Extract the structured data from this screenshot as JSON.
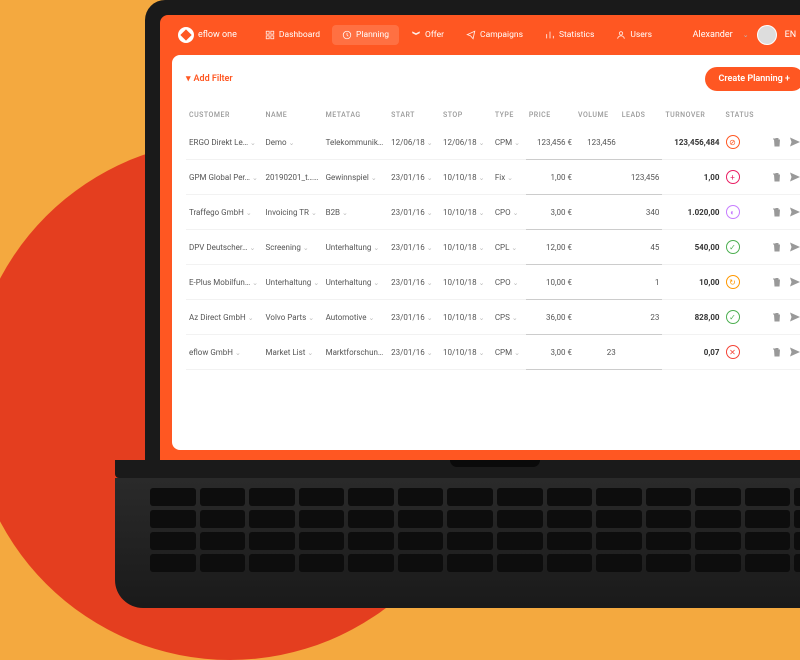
{
  "brand": "eflow one",
  "nav": {
    "dashboard": "Dashboard",
    "planning": "Planning",
    "offer": "Offer",
    "campaigns": "Campaigns",
    "statistics": "Statistics",
    "users": "Users"
  },
  "user": {
    "name": "Alexander",
    "lang": "EN"
  },
  "toolbar": {
    "add_filter": "Add Filter",
    "create": "Create Planning +"
  },
  "columns": {
    "customer": "CUSTOMER",
    "name": "NAME",
    "metatag": "METATAG",
    "start": "START",
    "stop": "STOP",
    "type": "TYPE",
    "price": "PRICE",
    "volume": "VOLUME",
    "leads": "LEADS",
    "turnover": "TURNOVER",
    "status": "STATUS"
  },
  "rows": [
    {
      "customer": "ERGO Direkt Le…",
      "name": "Demo",
      "metatag": "Telekommunikation",
      "start": "12/06/18",
      "stop": "12/06/18",
      "type": "CPM",
      "price": "123,456 €",
      "volume": "123,456",
      "leads": "",
      "turnover": "123,456,484",
      "status": "block"
    },
    {
      "customer": "GPM Global Per…",
      "name": "20190201_t…",
      "metatag": "Gewinnspiel",
      "start": "23/01/16",
      "stop": "10/10/18",
      "type": "Fix",
      "price": "1,00 €",
      "volume": "",
      "leads": "123,456",
      "turnover": "1,00",
      "status": "plus"
    },
    {
      "customer": "Traffego GmbH",
      "name": "Invoicing TR",
      "metatag": "B2B",
      "start": "23/01/16",
      "stop": "10/10/18",
      "type": "CPO",
      "price": "3,00 €",
      "volume": "",
      "leads": "340",
      "turnover": "1.020,00",
      "status": "wait"
    },
    {
      "customer": "DPV Deutscher…",
      "name": "Screening",
      "metatag": "Unterhaltung",
      "start": "23/01/16",
      "stop": "10/10/18",
      "type": "CPL",
      "price": "12,00 €",
      "volume": "",
      "leads": "45",
      "turnover": "540,00",
      "status": "ok"
    },
    {
      "customer": "E-Plus Mobilfun…",
      "name": "Unterhaltung",
      "metatag": "Unterhaltung",
      "start": "23/01/16",
      "stop": "10/10/18",
      "type": "CPO",
      "price": "10,00 €",
      "volume": "",
      "leads": "1",
      "turnover": "10,00",
      "status": "time"
    },
    {
      "customer": "Az Direct GmbH",
      "name": "Volvo Parts",
      "metatag": "Automotive",
      "start": "23/01/16",
      "stop": "10/10/18",
      "type": "CPS",
      "price": "36,00 €",
      "volume": "",
      "leads": "23",
      "turnover": "828,00",
      "status": "ok"
    },
    {
      "customer": "eflow GmbH",
      "name": "Market List",
      "metatag": "Marktforschung",
      "start": "23/01/16",
      "stop": "10/10/18",
      "type": "CPM",
      "price": "3,00 €",
      "volume": "23",
      "leads": "",
      "turnover": "0,07",
      "status": "x"
    }
  ]
}
